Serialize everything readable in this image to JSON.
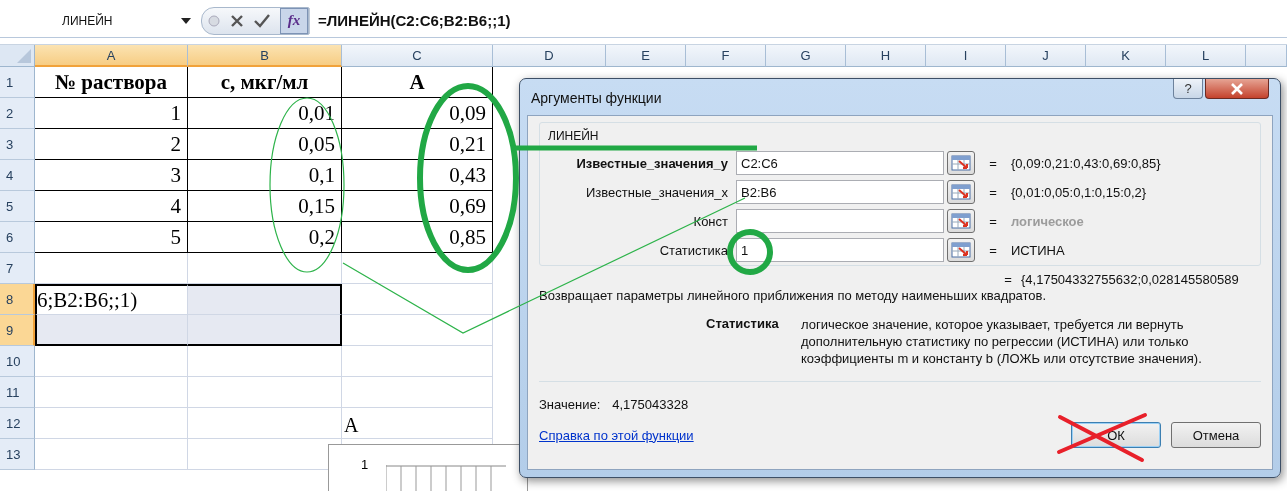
{
  "formula_bar": {
    "name_box": "ЛИНЕЙН",
    "function_button": "fx",
    "formula": "=ЛИНЕЙН(C2:C6;B2:B6;;1)"
  },
  "columns": [
    {
      "label": "A",
      "selected": true
    },
    {
      "label": "B",
      "selected": true
    },
    {
      "label": "C",
      "selected": false
    },
    {
      "label": "D",
      "selected": false
    },
    {
      "label": "E",
      "selected": false
    },
    {
      "label": "F",
      "selected": false
    },
    {
      "label": "G",
      "selected": false
    },
    {
      "label": "H",
      "selected": false
    },
    {
      "label": "I",
      "selected": false
    },
    {
      "label": "J",
      "selected": false
    },
    {
      "label": "K",
      "selected": false
    },
    {
      "label": "L",
      "selected": false
    }
  ],
  "rows": [
    {
      "number": "1",
      "selected": false,
      "kind": "table-header",
      "cells": [
        "№ раствора",
        "с, мкг/мл",
        "А"
      ]
    },
    {
      "number": "2",
      "selected": false,
      "kind": "table-row",
      "cells": [
        "1",
        "0,01",
        "0,09"
      ]
    },
    {
      "number": "3",
      "selected": false,
      "kind": "table-row",
      "cells": [
        "2",
        "0,05",
        "0,21"
      ]
    },
    {
      "number": "4",
      "selected": false,
      "kind": "table-row",
      "cells": [
        "3",
        "0,1",
        "0,43"
      ]
    },
    {
      "number": "5",
      "selected": false,
      "kind": "table-row",
      "cells": [
        "4",
        "0,15",
        "0,69"
      ]
    },
    {
      "number": "6",
      "selected": false,
      "kind": "table-row",
      "cells": [
        "5",
        "0,2",
        "0,85"
      ]
    },
    {
      "number": "7",
      "selected": false,
      "kind": "plain"
    },
    {
      "number": "8",
      "selected": true,
      "kind": "plain",
      "cells": [
        "6;B2:B6;;1)"
      ]
    },
    {
      "number": "9",
      "selected": true,
      "kind": "plain"
    },
    {
      "number": "10",
      "selected": false,
      "kind": "plain"
    },
    {
      "number": "11",
      "selected": false,
      "kind": "plain"
    },
    {
      "number": "12",
      "selected": false,
      "kind": "plain"
    },
    {
      "number": "13",
      "selected": false,
      "kind": "plain"
    }
  ],
  "chart": {
    "title": "А",
    "y_tick": "1"
  },
  "dialog": {
    "title": "Аргументы функции",
    "help_button": "?",
    "function": "ЛИНЕЙН",
    "arguments": [
      {
        "label": "Известные_значения_y",
        "required": true,
        "value": "C2:C6",
        "sign": "=",
        "result": "{0,09:0,21:0,43:0,69:0,85}",
        "hint": false
      },
      {
        "label": "Известные_значения_x",
        "required": false,
        "value": "B2:B6",
        "sign": "=",
        "result": "{0,01:0,05:0,1:0,15:0,2}",
        "hint": false
      },
      {
        "label": "Конст",
        "required": false,
        "sign": "=",
        "result": "логическое",
        "hint": true
      },
      {
        "label": "Статистика",
        "required": false,
        "value": "1",
        "sign": "=",
        "result": "ИСТИНА",
        "hint": false
      }
    ],
    "total": {
      "sign": "=",
      "result": "{4,17504332755632;0,028145580589"
    },
    "description": "Возвращает параметры линейного приближения по методу наименьших квадратов.",
    "argument_help": {
      "name": "Статистика",
      "text": "логическое значение, которое указывает, требуется ли вернуть дополнительную статистику по регрессии (ИСТИНА) или только коэффициенты m и константу b (ЛОЖЬ или отсутствие значения)."
    },
    "value_label": "Значение:",
    "value": "4,175043328",
    "help_link": "Справка по этой функции",
    "buttons": [
      "ОК",
      "Отмена"
    ]
  }
}
